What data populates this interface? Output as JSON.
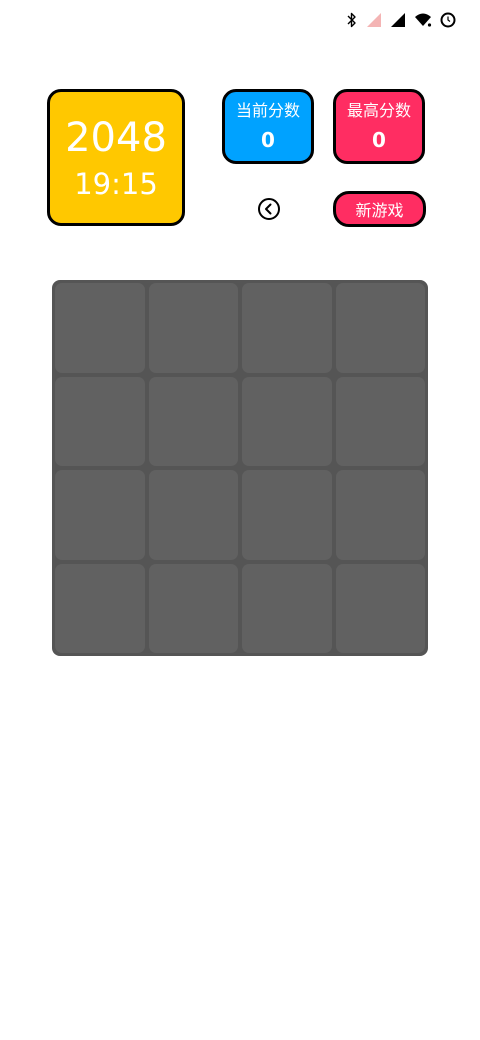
{
  "status_bar": {
    "icons": [
      "bluetooth-icon",
      "no-sim-signal-icon",
      "cell-signal-icon",
      "wifi-icon",
      "alarm-icon"
    ]
  },
  "logo": {
    "title": "2048",
    "time": "19:15",
    "color": "#ffc800"
  },
  "scores": {
    "current": {
      "label": "当前分数",
      "value": "0",
      "color": "#00a2ff"
    },
    "best": {
      "label": "最高分数",
      "value": "0",
      "color": "#ff2d62"
    }
  },
  "controls": {
    "undo_icon": "undo-back-icon",
    "new_game_label": "新游戏"
  },
  "board": {
    "size": 4,
    "cells": [
      [
        "",
        "",
        "",
        ""
      ],
      [
        "",
        "",
        "",
        ""
      ],
      [
        "",
        "",
        "",
        ""
      ],
      [
        "",
        "",
        "",
        ""
      ]
    ],
    "background": "#555555",
    "cell_color": "#616161"
  }
}
